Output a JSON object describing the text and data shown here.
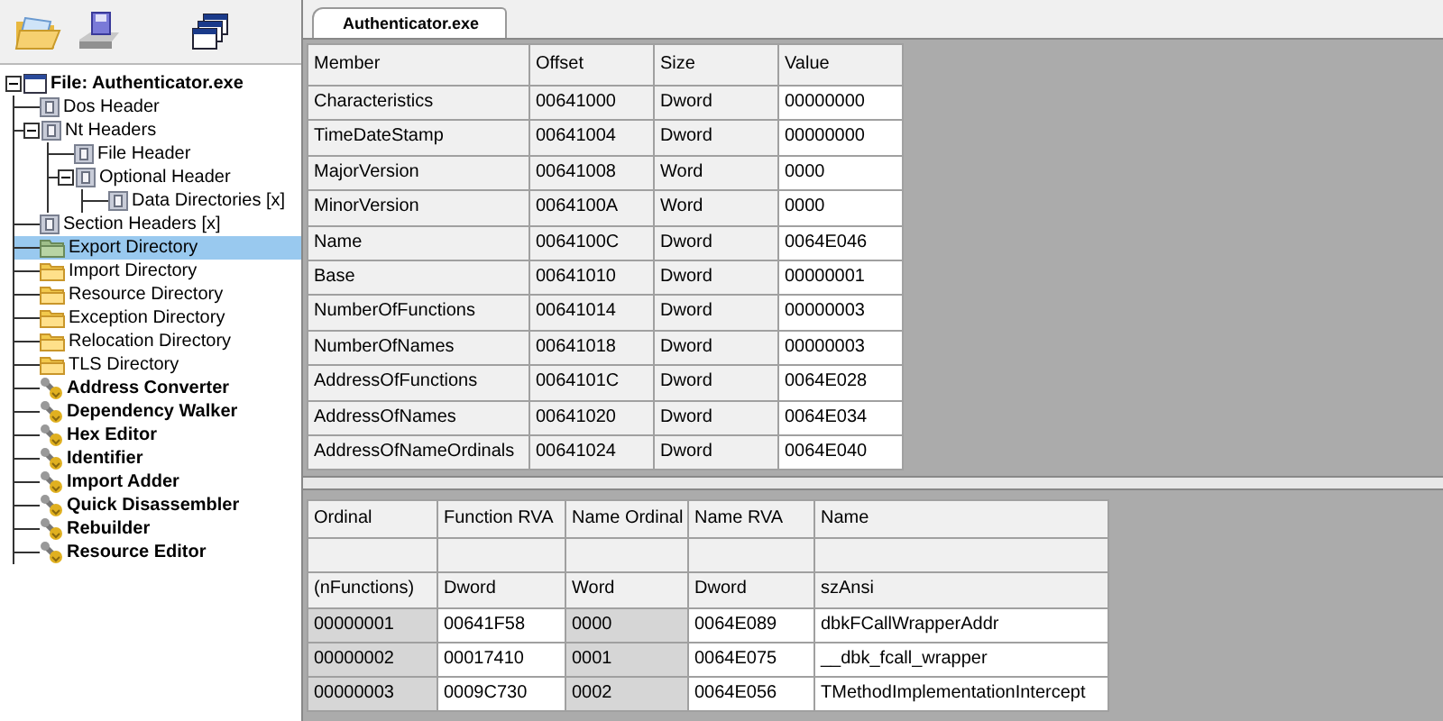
{
  "tree": {
    "items": [
      {
        "label": "File: Authenticator.exe",
        "kind": "file",
        "expanded": true,
        "selected": false,
        "children": [
          {
            "label": "Dos Header",
            "kind": "struct",
            "selected": false
          },
          {
            "label": "Nt Headers",
            "kind": "struct",
            "expanded": true,
            "selected": false,
            "children": [
              {
                "label": "File Header",
                "kind": "struct",
                "selected": false
              },
              {
                "label": "Optional Header",
                "kind": "struct",
                "expanded": true,
                "selected": false,
                "children": [
                  {
                    "label": "Data Directories [x]",
                    "kind": "struct",
                    "selected": false
                  }
                ]
              }
            ]
          },
          {
            "label": "Section Headers [x]",
            "kind": "struct",
            "selected": false
          },
          {
            "label": "Export Directory",
            "kind": "folder",
            "selected": true
          },
          {
            "label": "Import Directory",
            "kind": "folder",
            "selected": false
          },
          {
            "label": "Resource Directory",
            "kind": "folder",
            "selected": false
          },
          {
            "label": "Exception Directory",
            "kind": "folder",
            "selected": false
          },
          {
            "label": "Relocation Directory",
            "kind": "folder",
            "selected": false
          },
          {
            "label": "TLS Directory",
            "kind": "folder",
            "selected": false
          },
          {
            "label": "Address Converter",
            "kind": "tool",
            "selected": false
          },
          {
            "label": "Dependency Walker",
            "kind": "tool",
            "selected": false
          },
          {
            "label": "Hex Editor",
            "kind": "tool",
            "selected": false
          },
          {
            "label": "Identifier",
            "kind": "tool",
            "selected": false
          },
          {
            "label": "Import Adder",
            "kind": "tool",
            "selected": false
          },
          {
            "label": "Quick Disassembler",
            "kind": "tool",
            "selected": false
          },
          {
            "label": "Rebuilder",
            "kind": "tool",
            "selected": false
          },
          {
            "label": "Resource Editor",
            "kind": "tool",
            "selected": false
          }
        ]
      }
    ]
  },
  "tabs": [
    {
      "label": "Authenticator.exe",
      "selected": true
    }
  ],
  "members_table": {
    "columns": [
      "Member",
      "Offset",
      "Size",
      "Value"
    ],
    "rows": [
      [
        "Characteristics",
        "00641000",
        "Dword",
        "00000000"
      ],
      [
        "TimeDateStamp",
        "00641004",
        "Dword",
        "00000000"
      ],
      [
        "MajorVersion",
        "00641008",
        "Word",
        "0000"
      ],
      [
        "MinorVersion",
        "0064100A",
        "Word",
        "0000"
      ],
      [
        "Name",
        "0064100C",
        "Dword",
        "0064E046"
      ],
      [
        "Base",
        "00641010",
        "Dword",
        "00000001"
      ],
      [
        "NumberOfFunctions",
        "00641014",
        "Dword",
        "00000003"
      ],
      [
        "NumberOfNames",
        "00641018",
        "Dword",
        "00000003"
      ],
      [
        "AddressOfFunctions",
        "0064101C",
        "Dword",
        "0064E028"
      ],
      [
        "AddressOfNames",
        "00641020",
        "Dword",
        "0064E034"
      ],
      [
        "AddressOfNameOrdinals",
        "00641024",
        "Dword",
        "0064E040"
      ]
    ]
  },
  "exports_table": {
    "columns": [
      "Ordinal",
      "Function RVA",
      "Name Ordinal",
      "Name RVA",
      "Name"
    ],
    "type_row": [
      "(nFunctions)",
      "Dword",
      "Word",
      "Dword",
      "szAnsi"
    ],
    "rows": [
      [
        "00000001",
        "00641F58",
        "0000",
        "0064E089",
        "dbkFCallWrapperAddr"
      ],
      [
        "00000002",
        "00017410",
        "0001",
        "0064E075",
        "__dbk_fcall_wrapper"
      ],
      [
        "00000003",
        "0009C730",
        "0002",
        "0064E056",
        "TMethodImplementationIntercept"
      ]
    ]
  }
}
